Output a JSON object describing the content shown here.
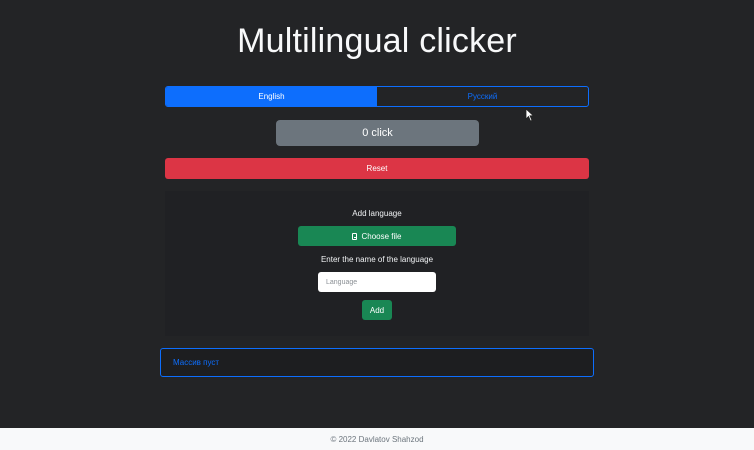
{
  "header": {
    "title": "Multilingual clicker"
  },
  "languages": {
    "tabs": [
      {
        "label": "English",
        "active": true
      },
      {
        "label": "Русский",
        "active": false
      }
    ]
  },
  "counter": {
    "label": "0 click"
  },
  "controls": {
    "reset_label": "Reset"
  },
  "add_language": {
    "heading": "Add language",
    "choose_file_label": "Choose file",
    "choose_file_icon": "file-icon",
    "name_label": "Enter the name of the language",
    "name_placeholder": "Language",
    "add_label": "Add"
  },
  "output": {
    "text": "Массив пуст"
  },
  "footer": {
    "text": "© 2022 Davlatov Shahzod"
  },
  "colors": {
    "primary": "#0d6efd",
    "danger": "#dc3545",
    "success": "#198754",
    "secondary": "#6c757d",
    "background": "#232426"
  }
}
